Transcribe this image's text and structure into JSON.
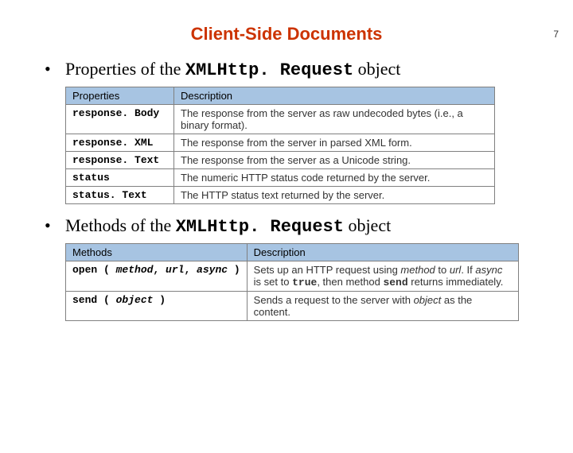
{
  "page_number": "7",
  "title": "Client-Side Documents",
  "bullet1_prefix": "Properties of the ",
  "bullet1_obj": "XMLHttp. Request",
  "bullet1_suffix": " object",
  "bullet2_prefix": "Methods of the ",
  "bullet2_obj": "XMLHttp. Request",
  "bullet2_suffix": " object",
  "props_header_col1": "Properties",
  "props_header_col2": "Description",
  "props": [
    {
      "name": "response. Body",
      "desc": "The response from the server as raw undecoded bytes (i.e., a binary format)."
    },
    {
      "name": "response. XML",
      "desc": "The response from the server in parsed XML form."
    },
    {
      "name": "response. Text",
      "desc": "The response from the server as a Unicode string."
    },
    {
      "name": "status",
      "desc": "The numeric HTTP status code returned by the server."
    },
    {
      "name": "status. Text",
      "desc": "The HTTP status text returned by the server."
    }
  ],
  "methods_header_col1": "Methods",
  "methods_header_col2": "Description",
  "methods": [
    {
      "sig_open": "open ( ",
      "sig_args": [
        "method",
        ", ",
        "url",
        ", ",
        "async"
      ],
      "sig_close": " )",
      "desc_parts": [
        "Sets up an HTTP request using ",
        "method",
        " to ",
        "url",
        ". If ",
        "async",
        " is set to ",
        "true",
        ", then method ",
        "send",
        " returns immediately."
      ]
    },
    {
      "sig_open": "send ( ",
      "sig_args": [
        "object"
      ],
      "sig_close": " )",
      "desc_parts": [
        "Sends a request to the server with ",
        "object",
        " as the content."
      ]
    }
  ]
}
